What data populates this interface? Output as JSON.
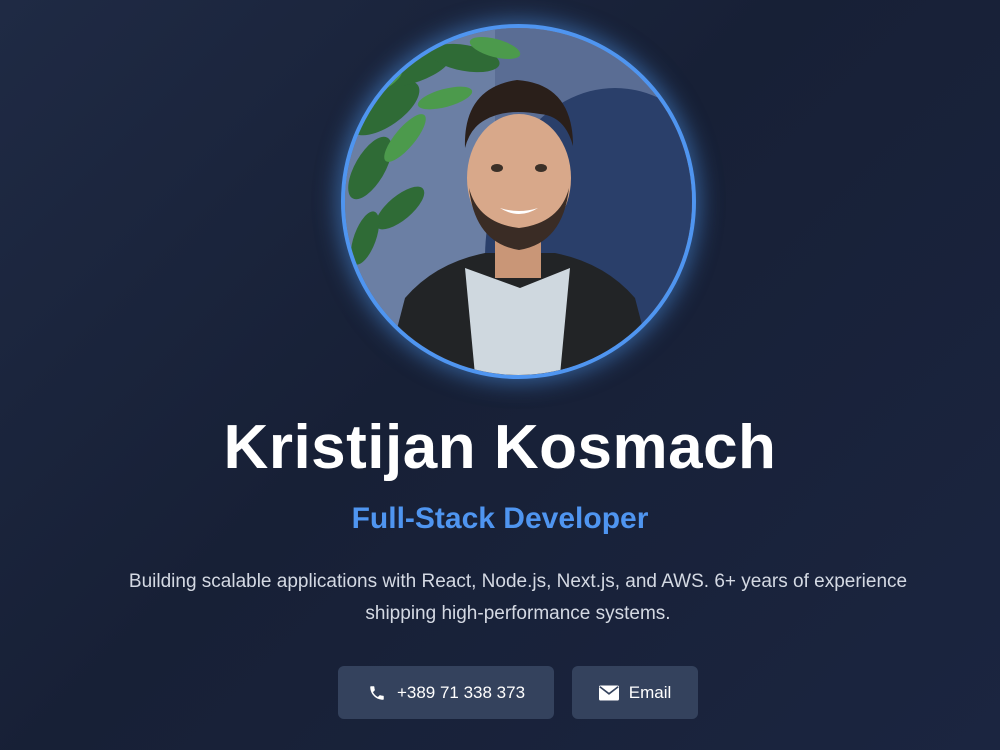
{
  "profile": {
    "name": "Kristijan Kosmach",
    "role": "Full-Stack Developer",
    "bio": "Building scalable applications with React, Node.js, Next.js, and AWS. 6+ years of experience shipping high-performance systems.",
    "avatar_alt": "profile-photo"
  },
  "contact": {
    "phone_label": "+389 71 338 373",
    "phone_icon": "phone-icon",
    "email_label": "Email",
    "email_icon": "envelope-icon"
  },
  "colors": {
    "accent": "#4f95f0",
    "background": "#1b2540",
    "button": "#34425d",
    "body_text": "#d4d9e3"
  }
}
